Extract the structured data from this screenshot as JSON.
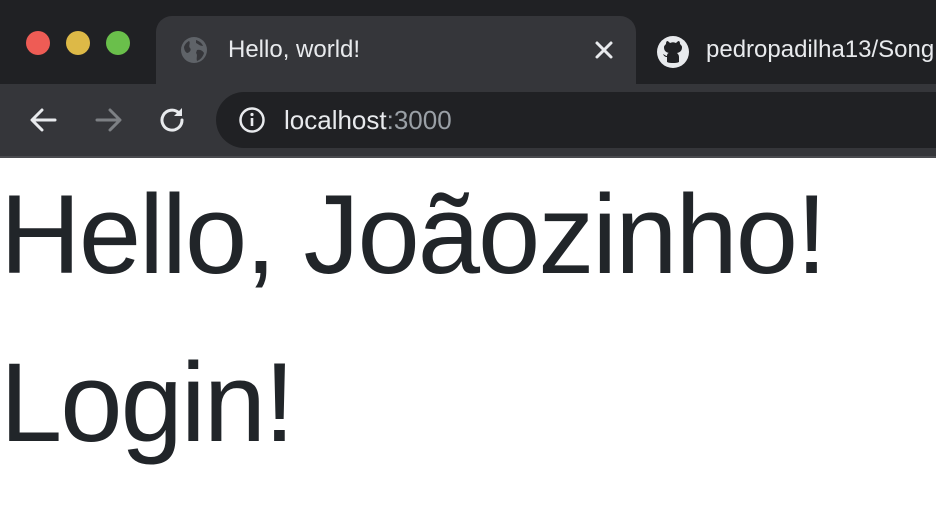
{
  "window": {
    "traffic_lights": [
      "close",
      "minimize",
      "maximize"
    ],
    "colors": {
      "close": "#ee5c55",
      "minimize": "#ddb947",
      "maximize": "#6abf4b"
    }
  },
  "tabs": [
    {
      "title": "Hello, world!",
      "icon": "globe-icon",
      "active": true,
      "close_icon": "close-icon"
    },
    {
      "title": "pedropadilha13/Song",
      "icon": "github-icon",
      "active": false
    }
  ],
  "toolbar": {
    "back_icon": "arrow-left-icon",
    "forward_icon": "arrow-right-icon",
    "reload_icon": "reload-icon",
    "site_info_icon": "info-icon",
    "url_host": "localhost",
    "url_port": ":3000"
  },
  "page": {
    "headings": [
      "Hello, Joãozinho!",
      "Login!"
    ],
    "text_color": "#212529"
  }
}
